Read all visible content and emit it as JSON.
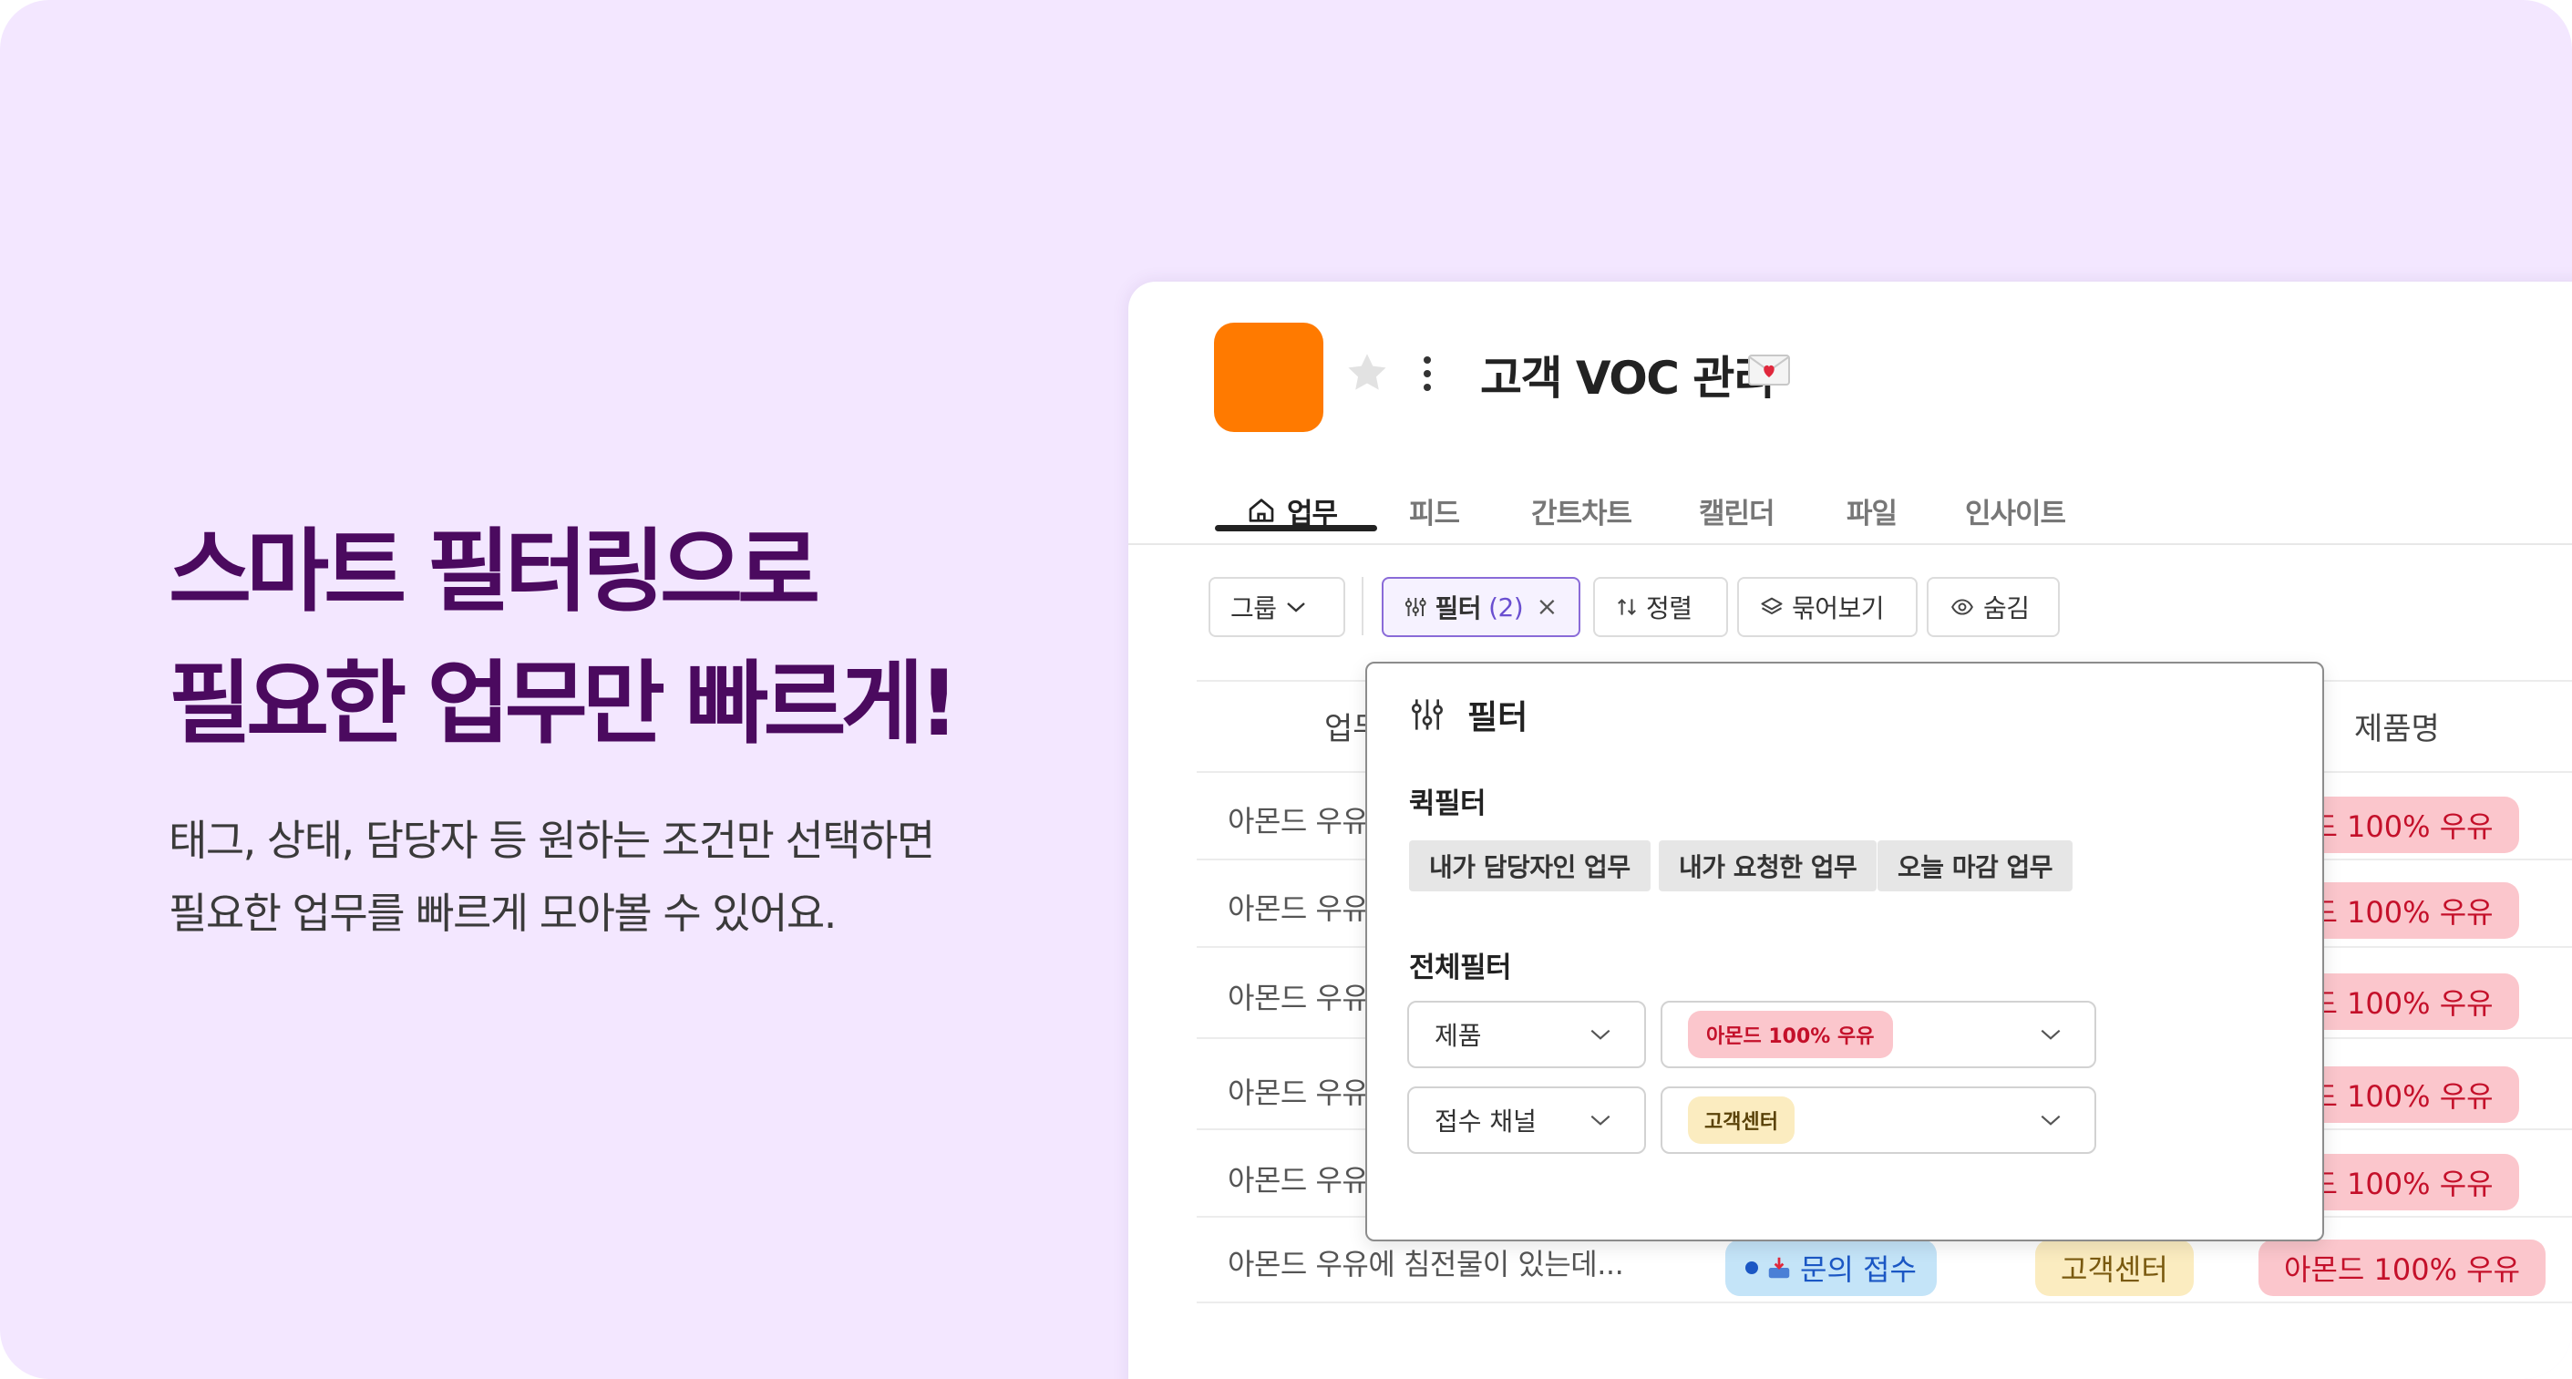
{
  "hero": {
    "headline_line1": "스마트 필터링으로",
    "headline_line2": "필요한 업무만 빠르게!",
    "subcopy_line1": "태그, 상태, 담당자 등 원하는 조건만 선택하면",
    "subcopy_line2": "필요한 업무를 빠르게 모아볼 수 있어요."
  },
  "project": {
    "title": "고객 VOC 관리",
    "logo_color": "#ff7a00",
    "icons": [
      "star-icon",
      "kebab-menu-icon",
      "love-letter-icon"
    ]
  },
  "tabs": [
    {
      "label": "업무",
      "active": true,
      "icon": "home-icon"
    },
    {
      "label": "피드"
    },
    {
      "label": "간트차트"
    },
    {
      "label": "캘린더"
    },
    {
      "label": "파일"
    },
    {
      "label": "인사이트"
    }
  ],
  "toolbar": {
    "group_label": "그룹",
    "filter_label": "필터",
    "filter_count": "(2)",
    "sort_label": "정렬",
    "bundle_label": "묶어보기",
    "hide_label": "숨김"
  },
  "table": {
    "header_task": "업무",
    "header_product": "제품명",
    "rows": [
      {
        "task": "아몬드 우유",
        "product": "몬드 100% 우유"
      },
      {
        "task": "아몬드 우유",
        "product": "몬드 100% 우유"
      },
      {
        "task": "아몬드 우유",
        "product": "몬드 100% 우유"
      },
      {
        "task": "아몬드 우유",
        "product": "몬드 100% 우유"
      },
      {
        "task": "아몬드 우유",
        "product": "몬드 100% 우유"
      },
      {
        "task": "아몬드 우유에 침전물이 있는데...",
        "status": "문의 접수",
        "channel": "고객센터",
        "product": "아몬드 100% 우유"
      }
    ]
  },
  "filter_popover": {
    "title": "필터",
    "quick_label": "퀵필터",
    "quick_filters": [
      "내가 담당자인 업무",
      "내가 요청한 업무",
      "오늘 마감 업무"
    ],
    "all_label": "전체필터",
    "conditions": [
      {
        "field": "제품",
        "value": "아몬드 100% 우유",
        "value_color": "#fbc6cc"
      },
      {
        "field": "접수 채널",
        "value": "고객센터",
        "value_color": "#fbecc0"
      }
    ]
  },
  "colors": {
    "background": "#f3e7ff",
    "headline": "#4b0a5f",
    "filter_accent": "#6a4fd0"
  }
}
